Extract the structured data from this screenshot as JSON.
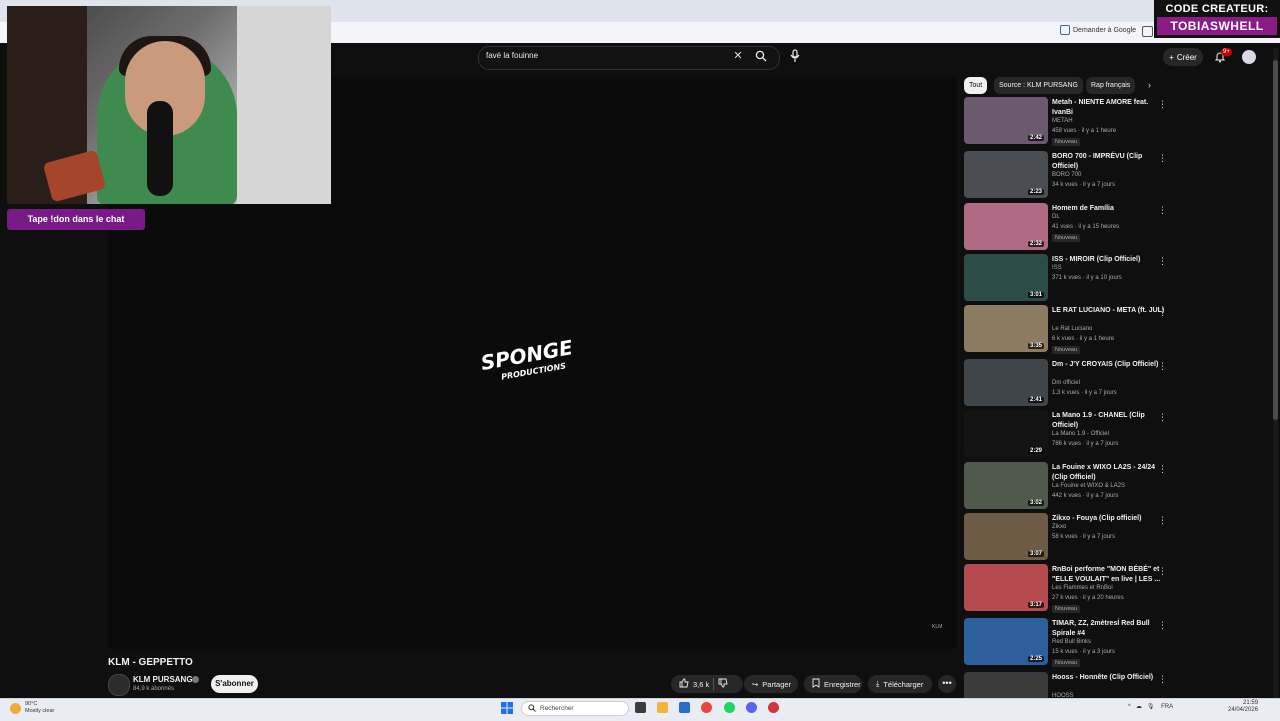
{
  "browser": {
    "ask_google": "Demander à Google"
  },
  "overlay": {
    "creator_code_label": "CODE CREATEUR:",
    "creator_code_value": "TOBIASWHELL",
    "chat_badge": "Tape !don dans le chat"
  },
  "header": {
    "search_value": "favé la fouinne",
    "create_label": "Créer",
    "notification_count": "9+"
  },
  "video": {
    "title": "KLM - GEPPETTO",
    "channel": "KLM PURSANG",
    "subscribers": "84,9 k abonnés",
    "subscribe_label": "S'abonner",
    "likes": "3,6 k",
    "share_label": "Partager",
    "save_label": "Enregistrer",
    "download_label": "Télécharger",
    "player_corner_text": "KLM"
  },
  "filters": {
    "chips": [
      "Tout",
      "Source : KLM PURSANG",
      "Rap français"
    ]
  },
  "recommendations": [
    {
      "title": "Metah - NIENTE AMORE feat. IvanBi",
      "channel": "METAH",
      "meta": "458 vues · il y a 1 heure",
      "badge": "Nouveau",
      "duration": "2:42",
      "color": "#6b5a6e"
    },
    {
      "title": "BORO 700 - IMPRÉVU (Clip Officiel)",
      "channel": "BORO 700",
      "meta": "34 k vues · il y a 7 jours",
      "badge": "",
      "duration": "2:23",
      "color": "#4a4d52"
    },
    {
      "title": "Homem de Família",
      "channel": "DL",
      "meta": "41 vues · il y a 15 heures",
      "badge": "Nouveau",
      "duration": "2:32",
      "color": "#b06a84"
    },
    {
      "title": "ISS - MIROIR (Clip Officiel)",
      "channel": "ISS",
      "meta": "371 k vues · il y a 10 jours",
      "badge": "",
      "duration": "3:01",
      "color": "#2c4c48"
    },
    {
      "title": "LE RAT LUCIANO - META (ft. JUL)",
      "channel": "Le Rat Luciano",
      "meta": "6 k vues · il y a 1 heure",
      "badge": "Nouveau",
      "duration": "3:35",
      "color": "#8a7b61"
    },
    {
      "title": "Dm - J'Y CROYAIS (Clip Officiel)",
      "channel": "Dm officiel",
      "meta": "1,3 k vues · il y a 7 jours",
      "badge": "",
      "duration": "2:41",
      "color": "#3f4548"
    },
    {
      "title": "La Mano 1.9 - CHANEL (Clip Officiel)",
      "channel": "La Mano 1.9 - Officiel",
      "meta": "786 k vues · il y a 7 jours",
      "badge": "",
      "duration": "2:29",
      "color": "#141414"
    },
    {
      "title": "La Fouine x WIXO LA2S - 24/24 (Clip Officiel)",
      "channel": "La Fouine  et WIXO & LA2S",
      "meta": "442 k vues · il y a 7 jours",
      "badge": "",
      "duration": "3:02",
      "color": "#4f5a4c"
    },
    {
      "title": "Zikxo - Fouya (Clip officiel)",
      "channel": "Zikxo",
      "meta": "58 k vues · il y a 7 jours",
      "badge": "",
      "duration": "3:07",
      "color": "#6d5b45"
    },
    {
      "title": "RnBoi performe \"MON BÉBÉ\" et \"ELLE VOULAIT\" en live | LES ...",
      "channel": "Les Flammes  et RnBoi",
      "meta": "27 k vues · il y a 20 heures",
      "badge": "Nouveau",
      "duration": "3:17",
      "color": "#b54a4f"
    },
    {
      "title": "TIMAR, ZZ, 2mètresÍ  Red Bull Spirale #4",
      "channel": "Red Bull Binks",
      "meta": "15 k vues · il y a 3 jours",
      "badge": "Nouveau",
      "duration": "2:25",
      "color": "#2d5f9c"
    },
    {
      "title": "Hooss - Honnête (Clip Officiel)",
      "channel": "HOOSS",
      "meta": "",
      "badge": "",
      "duration": "",
      "color": "#3b3b3b"
    }
  ],
  "taskbar": {
    "weather_temp": "90°C",
    "weather_desc": "Mostly clear",
    "search_label": "Rechercher",
    "language": "FRA",
    "time": "21:59",
    "date": "24/04/2026"
  }
}
